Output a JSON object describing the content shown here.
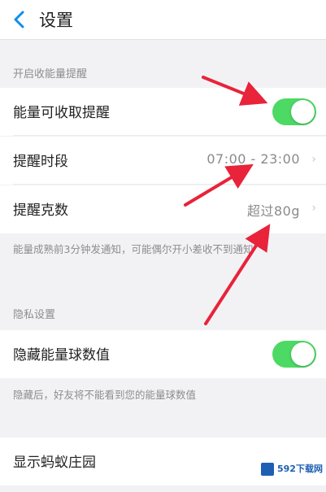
{
  "header": {
    "title": "设置",
    "back_icon": "chevron-left-icon"
  },
  "energy": {
    "section_label": "开启收能量提醒",
    "reminder_label": "能量可收取提醒",
    "reminder_on": true,
    "period_label": "提醒时段",
    "period_value": "07:00 - 23:00",
    "grams_label": "提醒克数",
    "grams_value": "超过80g",
    "description": "能量成熟前3分钟发通知，可能偶尔开小差收不到通知"
  },
  "privacy": {
    "section_label": "隐私设置",
    "hide_label": "隐藏能量球数值",
    "hide_on": true,
    "description": "隐藏后，好友将不能看到您的能量球数值"
  },
  "manor": {
    "label": "显示蚂蚁庄园"
  },
  "watermark": {
    "text": "592下载网"
  },
  "colors": {
    "toggle_on": "#4cd964",
    "accent": "#108ee9",
    "annotation_arrow": "#e8233a"
  }
}
